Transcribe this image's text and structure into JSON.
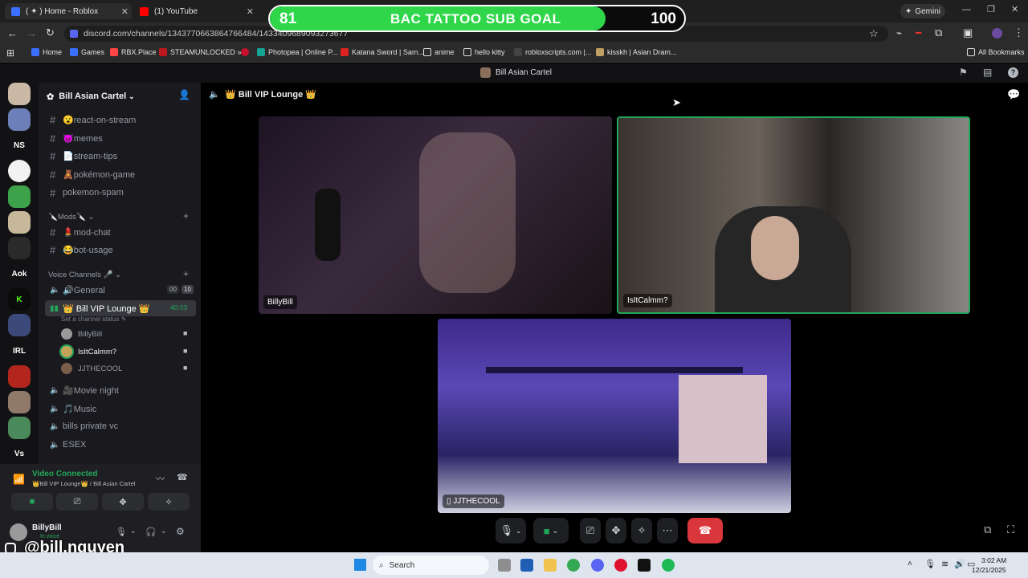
{
  "browser": {
    "tabs": [
      {
        "title": "( ✦ ) Home - Roblox",
        "color": "#3b6fff"
      },
      {
        "title": "(1) YouTube",
        "color": "#ff0000"
      }
    ],
    "url": "discord.com/channels/1343770663864766484/1433409689093273677",
    "gemini_label": "Gemini",
    "bookmarks": [
      "Home",
      "Games",
      "RBX.Place",
      "STEAMUNLOCKED »...",
      "Photopea | Online P...",
      "Katana Sword | Sam...",
      "anime",
      "hello kitty",
      "robloxscripts.com |...",
      "kisskh | Asian Dram..."
    ],
    "all_bookmarks_label": "All Bookmarks"
  },
  "goal": {
    "current": "81",
    "title": "BAC TATTOO SUB GOAL",
    "target": "100",
    "fraction": 0.81,
    "fill_color": "#2fd64a"
  },
  "discord": {
    "window_title": "Bill Asian Cartel",
    "server_name": "Bill Asian Cartel",
    "voice_channel_title": "👑 Bill VIP Lounge 👑",
    "rail_labels": [
      "NS",
      "Aok",
      "IRL",
      "Vs"
    ],
    "text_channels": [
      "😮react-on-stream",
      "😈memes",
      "📄stream-tips",
      "🧸pokémon-game",
      "pokemon-spam"
    ],
    "mods_category": "🔪Mods🔪",
    "mod_channels": [
      "💄mod-chat",
      "😂bot-usage"
    ],
    "voice_category": "Voice Channels 🎤",
    "general": {
      "name": "🔊General",
      "badge1": "00",
      "badge2": "10"
    },
    "active_voice": {
      "name": "👑 Bill VIP Lounge 👑",
      "timer": "40:03",
      "status": "Set a channel status"
    },
    "members": [
      "BillyBill",
      "IsItCalmm?",
      "JJTHECOOL"
    ],
    "other_voice": [
      "🎥Movie night",
      "🎵Music",
      "bills private vc",
      "ESEX"
    ],
    "voice_panel": {
      "status": "Video Connected",
      "location": "👑Bill VIP Lounge👑 / Bill Asian Cartel"
    },
    "user": {
      "name": "BillyBill",
      "status": "In voice"
    },
    "tiles": [
      {
        "label": "BillyBill"
      },
      {
        "label": "IsItCalmm?"
      },
      {
        "label": "JJTHECOOL"
      }
    ]
  },
  "watermark": "@bill.nguyen",
  "taskbar": {
    "search_placeholder": "Search",
    "time": "3:02 AM",
    "date": "12/21/2025"
  }
}
